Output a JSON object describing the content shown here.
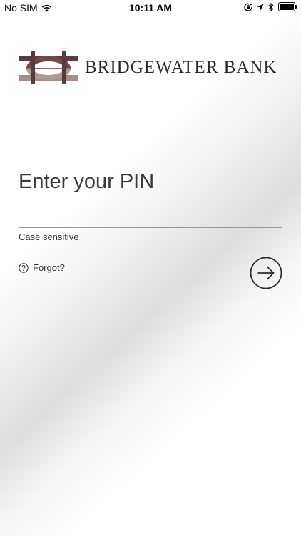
{
  "status_bar": {
    "carrier": "No SIM",
    "time": "10:11 AM"
  },
  "logo": {
    "text": "BRIDGEWATER BANK"
  },
  "pin": {
    "title": "Enter your PIN",
    "value": "",
    "hint": "Case sensitive",
    "forgot_label": "Forgot?"
  },
  "icons": [
    "wifi-icon",
    "rotation-lock-icon",
    "location-icon",
    "bluetooth-icon",
    "battery-icon",
    "bank-logo-icon",
    "help-icon",
    "arrow-right-circle-icon"
  ]
}
